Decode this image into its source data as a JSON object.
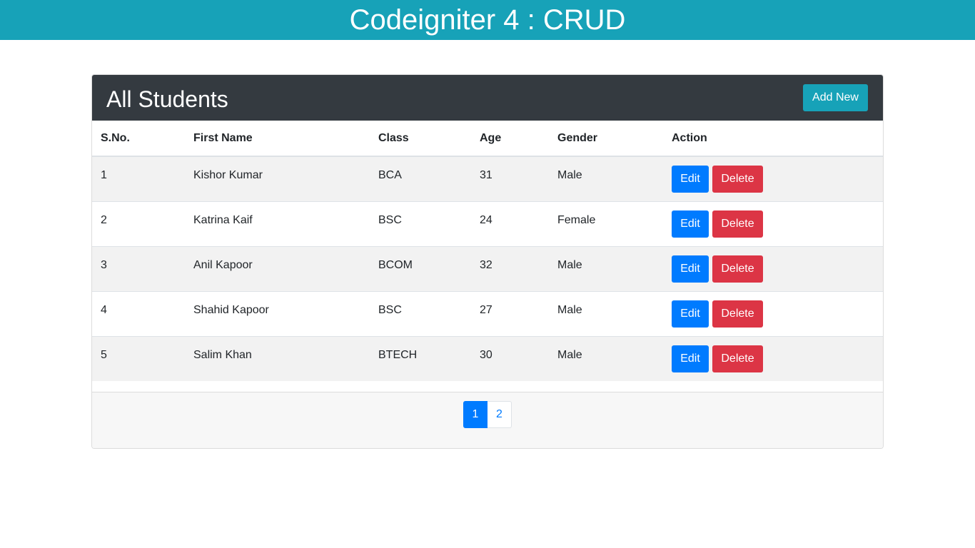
{
  "header": {
    "title": "Codeigniter 4 : CRUD"
  },
  "card": {
    "title": "All Students",
    "add_button_label": "Add New"
  },
  "table": {
    "columns": [
      "S.No.",
      "First Name",
      "Class",
      "Age",
      "Gender",
      "Action"
    ],
    "rows": [
      {
        "sno": "1",
        "first_name": "Kishor Kumar",
        "class": "BCA",
        "age": "31",
        "gender": "Male"
      },
      {
        "sno": "2",
        "first_name": "Katrina Kaif",
        "class": "BSC",
        "age": "24",
        "gender": "Female"
      },
      {
        "sno": "3",
        "first_name": "Anil Kapoor",
        "class": "BCOM",
        "age": "32",
        "gender": "Male"
      },
      {
        "sno": "4",
        "first_name": "Shahid Kapoor",
        "class": "BSC",
        "age": "27",
        "gender": "Male"
      },
      {
        "sno": "5",
        "first_name": "Salim Khan",
        "class": "BTECH",
        "age": "30",
        "gender": "Male"
      }
    ],
    "edit_label": "Edit",
    "delete_label": "Delete"
  },
  "pagination": {
    "pages": [
      "1",
      "2"
    ],
    "current": "1"
  },
  "colors": {
    "brand": "#17a2b8",
    "header_dark": "#343a40",
    "primary": "#007bff",
    "danger": "#dc3545"
  }
}
